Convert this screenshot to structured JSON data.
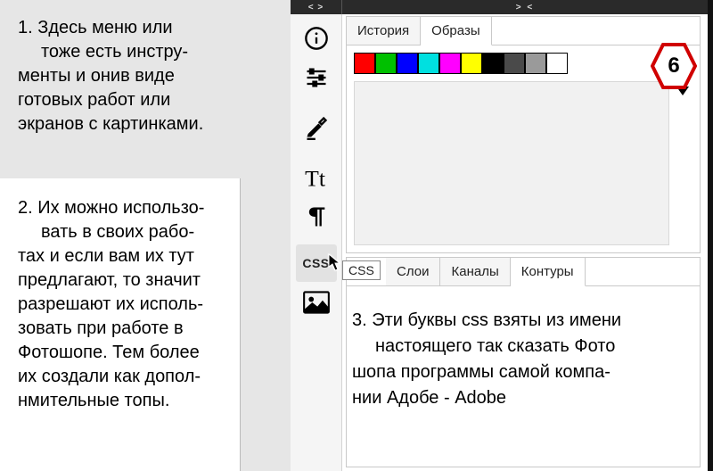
{
  "topbar": {
    "left_glyph": "< >",
    "center_glyph": "> <"
  },
  "notes": {
    "n1": "1. Здесь меню или\n    тоже есть инстру-\nменты и онив виде\nготовых работ или\nэкранов с картинками.",
    "n2": "2. Их можно использо-\n    вать в своих рабо-\nтах и если вам их тут\nпредлагают, то значит\nразрешают их исполь-\nзовать при работе в\nФотошопе. Тем более\nих создали как допол-\nнмительные топы.",
    "n3": "3. Эти буквы css взяты из имени\n    настоящего так сказать Фото\nшопа программы самой компа-\nнии Адобе - Adobe"
  },
  "tools": {
    "css_label": "CSS"
  },
  "panel_top": {
    "tabs": [
      "История",
      "Образы"
    ],
    "active_tab": 1,
    "swatches": [
      "#ff0000",
      "#00c000",
      "#0000ff",
      "#00e0e0",
      "#ff00ff",
      "#ffff00",
      "#000000",
      "#4a4a4a",
      "#9a9a9a",
      "#ffffff"
    ]
  },
  "panel_bottom": {
    "tabs": [
      "Слои",
      "Каналы",
      "Контуры"
    ],
    "active_tab": 2
  },
  "tooltip": {
    "css": "CSS"
  },
  "badge": {
    "label": "6"
  }
}
